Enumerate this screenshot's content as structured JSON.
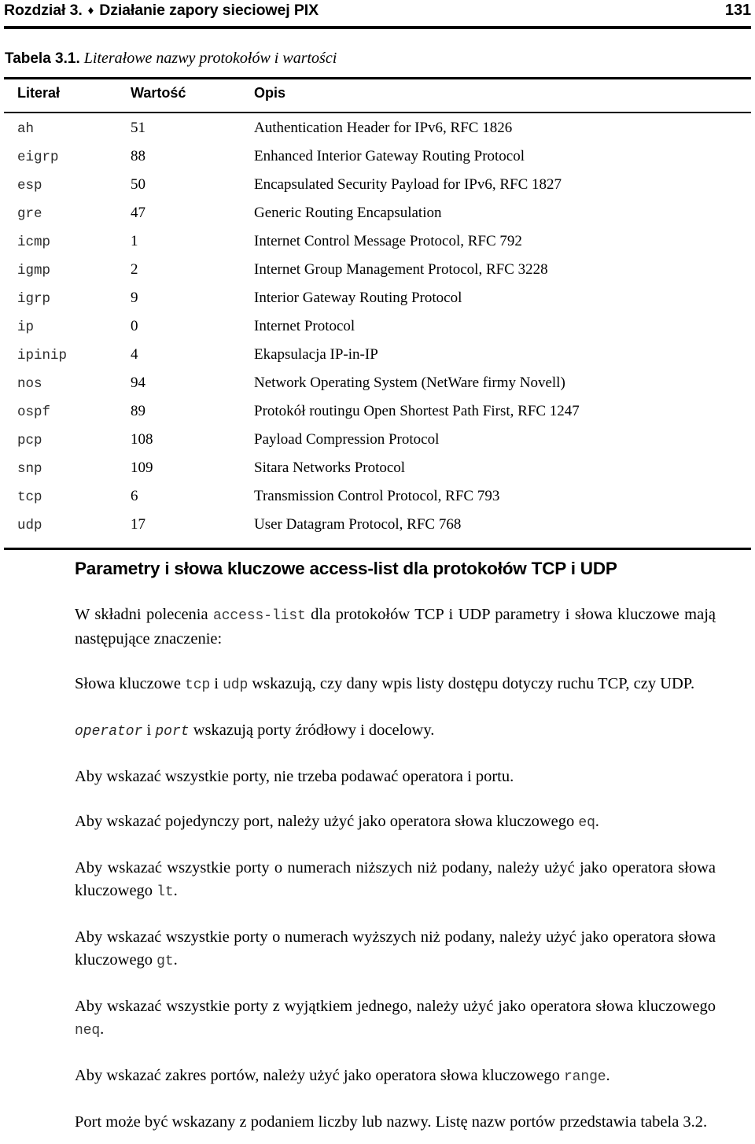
{
  "running_head": {
    "chapter": "Rozdział 3.",
    "separator_icon": "♦",
    "title": "Działanie zapory sieciowej PIX",
    "page_number": "131"
  },
  "table": {
    "caption_label": "Tabela 3.1.",
    "caption_title": "Literałowe nazwy protokołów i wartości",
    "columns": [
      "Literał",
      "Wartość",
      "Opis"
    ],
    "rows": [
      {
        "literal": "ah",
        "value": "51",
        "desc": "Authentication Header for IPv6, RFC 1826"
      },
      {
        "literal": "eigrp",
        "value": "88",
        "desc": "Enhanced Interior Gateway Routing Protocol"
      },
      {
        "literal": "esp",
        "value": "50",
        "desc": "Encapsulated Security Payload for IPv6, RFC 1827"
      },
      {
        "literal": "gre",
        "value": "47",
        "desc": "Generic Routing Encapsulation"
      },
      {
        "literal": "icmp",
        "value": "1",
        "desc": "Internet Control Message Protocol, RFC 792"
      },
      {
        "literal": "igmp",
        "value": "2",
        "desc": "Internet Group Management Protocol, RFC 3228"
      },
      {
        "literal": "igrp",
        "value": "9",
        "desc": "Interior Gateway Routing Protocol"
      },
      {
        "literal": "ip",
        "value": "0",
        "desc": "Internet Protocol"
      },
      {
        "literal": "ipinip",
        "value": "4",
        "desc": "Ekapsulacja IP-in-IP"
      },
      {
        "literal": "nos",
        "value": "94",
        "desc": "Network Operating System (NetWare firmy Novell)"
      },
      {
        "literal": "ospf",
        "value": "89",
        "desc": "Protokół routingu Open Shortest Path First, RFC 1247"
      },
      {
        "literal": "pcp",
        "value": "108",
        "desc": "Payload Compression Protocol"
      },
      {
        "literal": "snp",
        "value": "109",
        "desc": "Sitara Networks Protocol"
      },
      {
        "literal": "tcp",
        "value": "6",
        "desc": "Transmission Control Protocol, RFC 793"
      },
      {
        "literal": "udp",
        "value": "17",
        "desc": "User Datagram Protocol, RFC 768"
      }
    ]
  },
  "section": {
    "heading": "Parametry i słowa kluczowe access-list dla protokołów TCP i UDP",
    "paragraphs": {
      "p1_a": "W składni polecenia ",
      "p1_code": "access-list",
      "p1_b": " dla protokołów TCP i UDP parametry i słowa kluczowe mają następujące znaczenie:",
      "p2_a": "Słowa kluczowe ",
      "p2_code1": "tcp",
      "p2_b": " i ",
      "p2_code2": "udp",
      "p2_c": " wskazują, czy dany wpis listy dostępu dotyczy ruchu TCP, czy UDP.",
      "p3_code1": "operator",
      "p3_a": " i ",
      "p3_code2": "port",
      "p3_b": " wskazują porty źródłowy i docelowy.",
      "p4": "Aby wskazać wszystkie porty, nie trzeba podawać operatora i portu.",
      "p5_a": "Aby wskazać pojedynczy port, należy użyć jako operatora słowa kluczowego ",
      "p5_code": "eq",
      "p5_b": ".",
      "p6_a": "Aby wskazać wszystkie porty o numerach niższych niż podany, należy użyć jako operatora słowa kluczowego ",
      "p6_code": "lt",
      "p6_b": ".",
      "p7_a": "Aby wskazać wszystkie porty o numerach wyższych niż podany, należy użyć jako operatora słowa kluczowego ",
      "p7_code": "gt",
      "p7_b": ".",
      "p8_a": "Aby wskazać wszystkie porty z wyjątkiem jednego, należy użyć jako operatora słowa kluczowego ",
      "p8_code": "neq",
      "p8_b": ".",
      "p9_a": "Aby wskazać zakres portów, należy użyć jako operatora słowa kluczowego ",
      "p9_code": "range",
      "p9_b": ".",
      "p10": "Port może być wskazany z podaniem liczby lub nazwy. Listę nazw portów przedstawia tabela 3.2."
    }
  }
}
